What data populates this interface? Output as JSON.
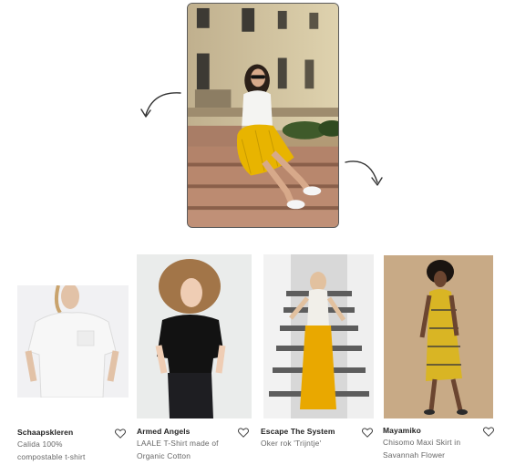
{
  "hero": {
    "icon": "hero-photo-woman-sitting-on-steps"
  },
  "arrows": {
    "left_icon": "curved-arrow-left-icon",
    "right_icon": "curved-arrow-right-icon"
  },
  "products": [
    {
      "brand": "Schaapskleren",
      "line1": "Calida 100%",
      "line2": "compostable t-shirt",
      "icon": "heart-icon"
    },
    {
      "brand": "Armed Angels",
      "line1": "LAALE T-Shirt made of",
      "line2": "Organic Cotton",
      "icon": "heart-icon"
    },
    {
      "brand": "Escape The System",
      "line1": "Oker rok 'Trijntje'",
      "line2": "",
      "icon": "heart-icon"
    },
    {
      "brand": "Mayamiko",
      "line1": "Chisomo Maxi Skirt in",
      "line2": "Savannah Flower",
      "icon": "heart-icon"
    }
  ],
  "colors": {
    "accent_yellow": "#e8b400",
    "text": "#222222",
    "muted": "#666666"
  }
}
